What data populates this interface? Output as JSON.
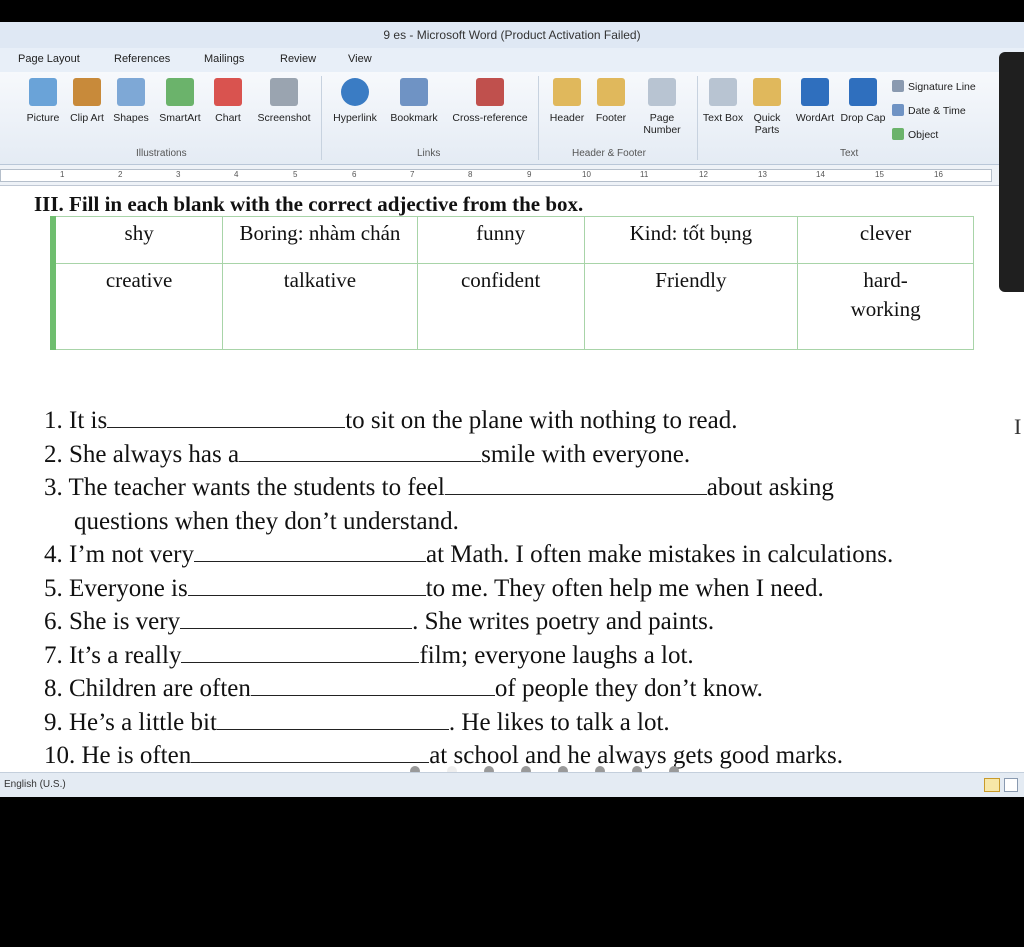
{
  "window": {
    "title": "9 es - Microsoft Word (Product Activation Failed)"
  },
  "tabs": [
    "Page Layout",
    "References",
    "Mailings",
    "Review",
    "View"
  ],
  "ribbon": {
    "buttons": [
      {
        "label": "Picture",
        "icon": "picture-icon",
        "color": "#6aa3d8"
      },
      {
        "label": "Clip Art",
        "icon": "clip-art-icon",
        "color": "#c88a3a"
      },
      {
        "label": "Shapes",
        "icon": "shapes-icon",
        "color": "#7ea8d6"
      },
      {
        "label": "SmartArt",
        "icon": "smartart-icon",
        "color": "#6bb36b"
      },
      {
        "label": "Chart",
        "icon": "chart-icon",
        "color": "#d9534f"
      },
      {
        "label": "Screenshot",
        "icon": "screenshot-icon",
        "color": "#9aa4b0"
      },
      {
        "label": "Hyperlink",
        "icon": "hyperlink-icon",
        "color": "#3a7cc4"
      },
      {
        "label": "Bookmark",
        "icon": "bookmark-icon",
        "color": "#6f93c4"
      },
      {
        "label": "Cross-reference",
        "icon": "cross-reference-icon",
        "color": "#c0504d"
      },
      {
        "label": "Header",
        "icon": "header-icon",
        "color": "#e0b85c"
      },
      {
        "label": "Footer",
        "icon": "footer-icon",
        "color": "#e0b85c"
      },
      {
        "label": "Page Number",
        "icon": "page-number-icon",
        "color": "#b8c4d2"
      },
      {
        "label": "Text Box",
        "icon": "text-box-icon",
        "color": "#b8c4d2"
      },
      {
        "label": "Quick Parts",
        "icon": "quick-parts-icon",
        "color": "#e0b85c"
      },
      {
        "label": "WordArt",
        "icon": "wordart-icon",
        "color": "#2f6fbe"
      },
      {
        "label": "Drop Cap",
        "icon": "drop-cap-icon",
        "color": "#2f6fbe"
      }
    ],
    "groups": [
      "Illustrations",
      "Links",
      "Header & Footer",
      "Text"
    ],
    "small_items": [
      "Signature Line",
      "Date & Time",
      "Object"
    ]
  },
  "ruler": {
    "numbers": [
      "1",
      "2",
      "3",
      "4",
      "5",
      "6",
      "7",
      "8",
      "9",
      "10",
      "11",
      "12",
      "13",
      "14",
      "15",
      "16"
    ]
  },
  "doc": {
    "heading": "III. Fill in each blank with the correct adjective from the box.",
    "box_rows": [
      [
        "shy",
        "Boring: nhàm chán",
        "funny",
        "Kind: tốt bụng",
        "clever"
      ],
      [
        "creative",
        "talkative",
        "confident",
        "Friendly",
        "hard-working"
      ]
    ],
    "exercises": [
      {
        "pre": "1. It is",
        "post": "to sit on the plane with nothing to read."
      },
      {
        "pre": "2. She always has a",
        "post": "smile with everyone."
      },
      {
        "pre": "3. The teacher wants the students to feel",
        "post": "about asking",
        "continuation": "questions when they don’t understand."
      },
      {
        "pre": "4. I’m not very",
        "post": "at Math. I often make mistakes in calculations."
      },
      {
        "pre": "5. Everyone is",
        "post": "to me. They often help me when I need."
      },
      {
        "pre": "6. She is very",
        "post": ". She writes poetry and paints."
      },
      {
        "pre": "7. It’s a really",
        "post": "film; everyone laughs a lot."
      },
      {
        "pre": "8. Children are often",
        "post": "of people they don’t know."
      },
      {
        "pre": "9. He’s a little bit",
        "post": ". He likes to talk a lot."
      },
      {
        "pre": "10. He is often",
        "post": "at school and he always gets good marks."
      }
    ]
  },
  "status": {
    "language": "English (U.S.)"
  }
}
